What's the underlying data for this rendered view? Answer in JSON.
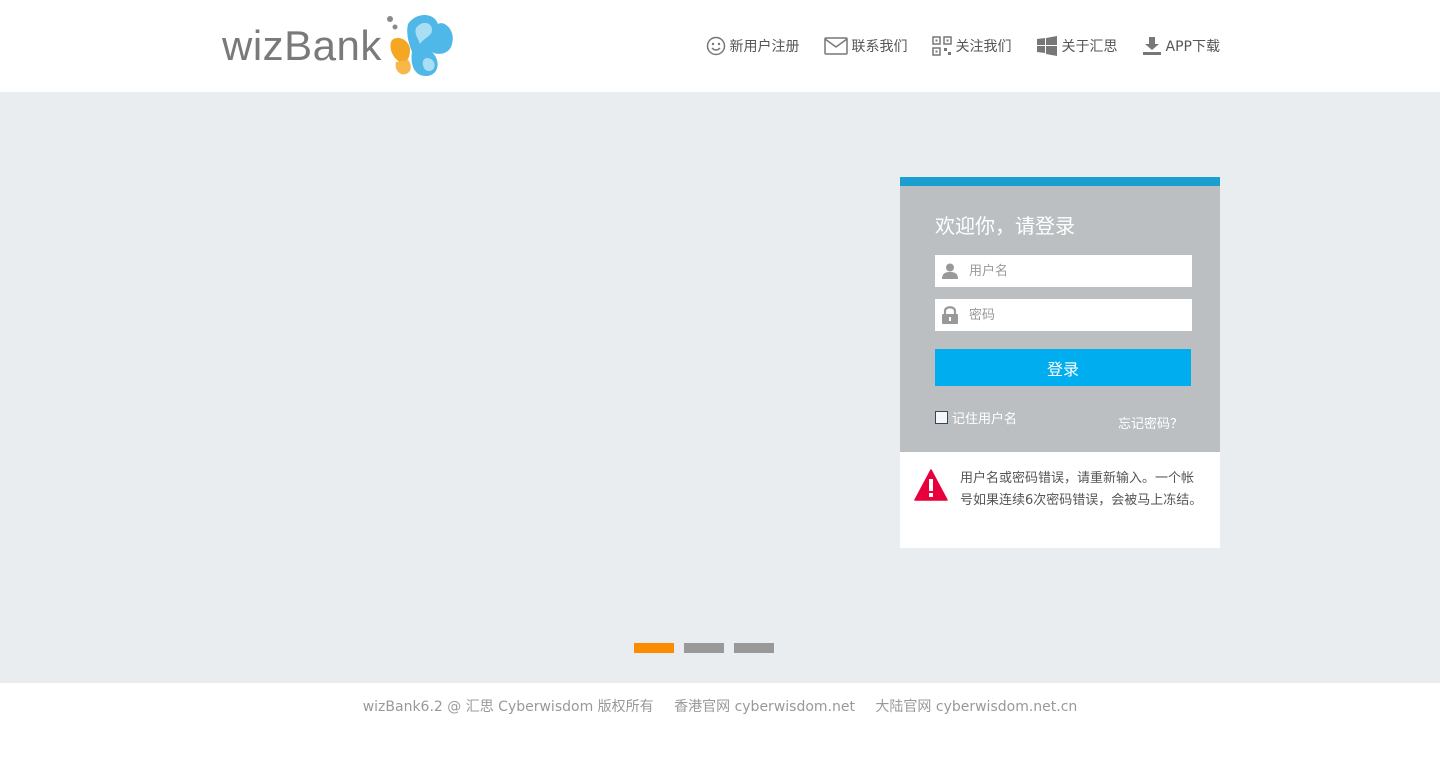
{
  "header": {
    "logo_text": "wizBank",
    "nav": [
      {
        "label": "新用户注册",
        "icon": "smiley-icon"
      },
      {
        "label": "联系我们",
        "icon": "envelope-icon"
      },
      {
        "label": "关注我们",
        "icon": "qrcode-icon"
      },
      {
        "label": "关于汇思",
        "icon": "windows-icon"
      },
      {
        "label": "APP下载",
        "icon": "download-icon"
      }
    ]
  },
  "login": {
    "title": "欢迎你，请登录",
    "username_placeholder": "用户名",
    "password_placeholder": "密码",
    "submit_label": "登录",
    "remember_label": "记住用户名",
    "forgot_label": "忘记密码？"
  },
  "error": {
    "message": "用户名或密码错误，请重新输入。一个帐号如果连续6次密码错误，会被马上冻结。"
  },
  "carousel": {
    "total": 3,
    "active": 1
  },
  "footer": {
    "copyright": "wizBank6.2 @ 汇思 Cyberwisdom 版权所有",
    "hk_site": "香港官网 cyberwisdom.net",
    "cn_site": "大陆官网 cyberwisdom.net.cn"
  },
  "colors": {
    "accent": "#00aeef",
    "panel_top_border": "#1b9fd1",
    "panel_bg": "#bbbfc2",
    "banner_bg": "#e9edf0",
    "carousel_active": "#fb8c00",
    "carousel_inactive": "#999999",
    "error_icon": "#e8003d"
  }
}
